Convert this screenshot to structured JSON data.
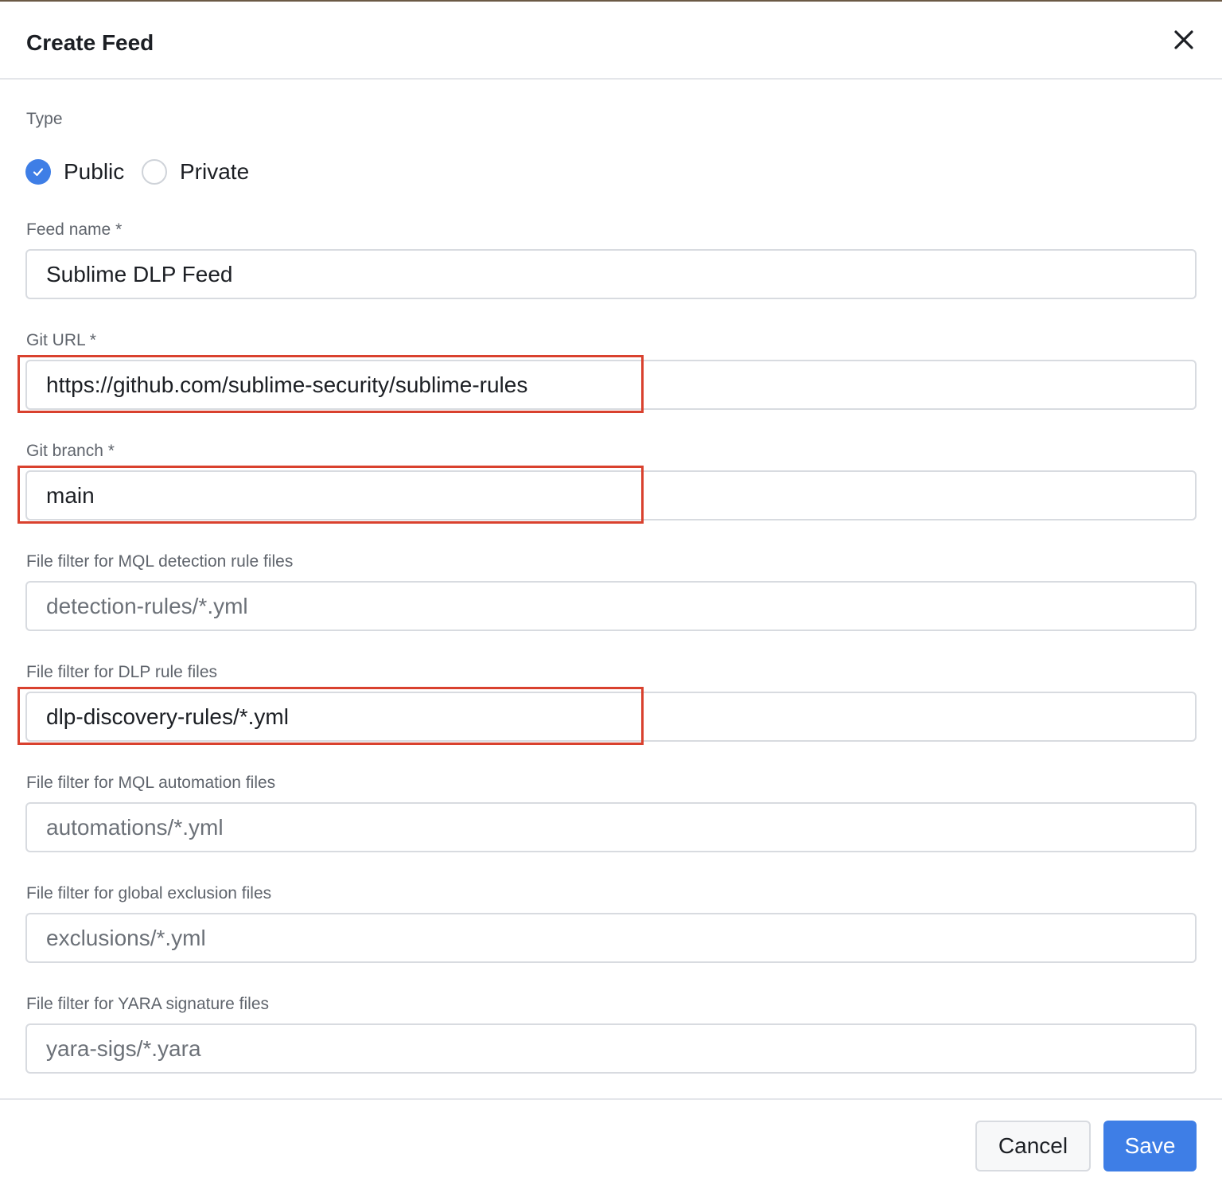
{
  "dialog": {
    "title": "Create Feed",
    "close_icon": "close-icon"
  },
  "type": {
    "label": "Type",
    "options": [
      {
        "label": "Public",
        "checked": true
      },
      {
        "label": "Private",
        "checked": false
      }
    ]
  },
  "fields": {
    "feed_name": {
      "label": "Feed name *",
      "value": "Sublime DLP Feed",
      "placeholder": ""
    },
    "git_url": {
      "label": "Git URL *",
      "value": "https://github.com/sublime-security/sublime-rules",
      "placeholder": ""
    },
    "git_branch": {
      "label": "Git branch *",
      "value": "main",
      "placeholder": ""
    },
    "mql_detection": {
      "label": "File filter for MQL detection rule files",
      "value": "",
      "placeholder": "detection-rules/*.yml"
    },
    "dlp_rules": {
      "label": "File filter for DLP rule files",
      "value": "dlp-discovery-rules/*.yml",
      "placeholder": ""
    },
    "mql_automation": {
      "label": "File filter for MQL automation files",
      "value": "",
      "placeholder": "automations/*.yml"
    },
    "global_exclusion": {
      "label": "File filter for global exclusion files",
      "value": "",
      "placeholder": "exclusions/*.yml"
    },
    "yara_signature": {
      "label": "File filter for YARA signature files",
      "value": "",
      "placeholder": "yara-sigs/*.yara"
    }
  },
  "footer": {
    "cancel_label": "Cancel",
    "save_label": "Save"
  },
  "colors": {
    "accent": "#3e7ee6",
    "highlight_border": "#d9412e"
  }
}
